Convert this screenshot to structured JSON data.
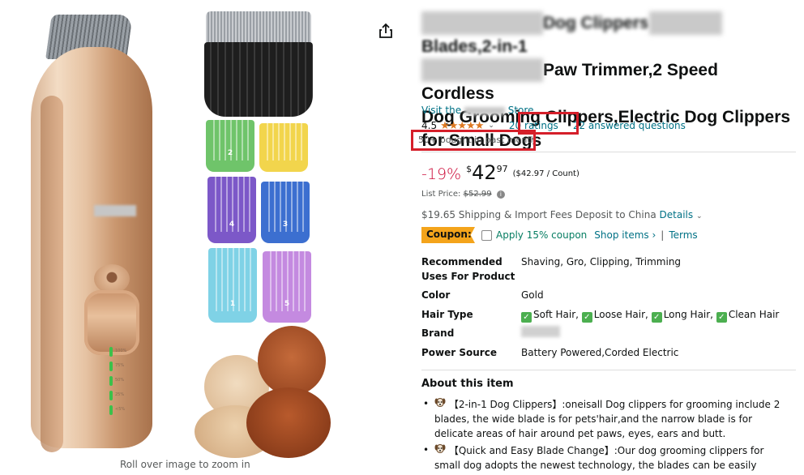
{
  "image_panel": {
    "zoom_hint": "Roll over image to zoom in",
    "guard_numbers": [
      "2",
      "4",
      "3",
      "1",
      "5"
    ],
    "led_labels": [
      "100%",
      "75%",
      "50%",
      "25%",
      "<5%"
    ]
  },
  "product": {
    "title_line1_visible": "Dog Clippers",
    "title_line1_tail": "Blades,2-in-1",
    "title_line2_visible": "Paw Trimmer,2 Speed Cordless",
    "title_line3": "Dog Grooming Clippers,Electric Dog Clippers",
    "title_line4": "for Small Dogs",
    "store_prefix": "Visit the",
    "store_suffix": "Store",
    "rating_value": "4.5",
    "stars": "★★★★★",
    "ratings_link": "20 ratings",
    "questions_link": "22 answered questions",
    "bought": "50+ bought in past month"
  },
  "price": {
    "discount": "-19%",
    "currency": "$",
    "whole": "42",
    "fraction": "97",
    "per_unit": "($42.97 / Count)",
    "list_price_label": "List Price:",
    "list_price": "$52.99",
    "info_icon": "i"
  },
  "shipping": {
    "text": "$19.65 Shipping & Import Fees Deposit to China",
    "details_link": "Details",
    "chevron": "⌄"
  },
  "coupon": {
    "badge": "Coupon:",
    "apply_text": "Apply 15% coupon",
    "shop_items": "Shop items ›",
    "separator": "|",
    "terms": "Terms"
  },
  "specs": {
    "recommended_label": "Recommended Uses For Product",
    "recommended_value": "Shaving, Gro, Clipping, Trimming",
    "color_label": "Color",
    "color_value": "Gold",
    "hair_label": "Hair Type",
    "hair_values": [
      "Soft Hair,",
      "Loose Hair,",
      "Long Hair,",
      "Clean Hair"
    ],
    "brand_label": "Brand",
    "power_label": "Power Source",
    "power_value": "Battery Powered,Corded Electric"
  },
  "about": {
    "heading": "About this item",
    "bullet1": "【2-in-1 Dog Clippers】:oneisall Dog clippers for grooming include 2 blades, the wide blade is for pets'hair,and the narrow blade is for delicate areas of hair around pet paws, eyes, ears and butt.",
    "bullet2": "【Quick and Easy Blade Change】:Our dog grooming clippers for small dog adopts the newest technology, the blades can be easily replaced by"
  },
  "colors": {
    "link": "#007185",
    "discount_red": "#cc0c39",
    "coupon_orange": "#f4a41b",
    "coupon_green": "#067d62",
    "highlight_box": "#d51f2a",
    "star_orange": "#de7921"
  }
}
